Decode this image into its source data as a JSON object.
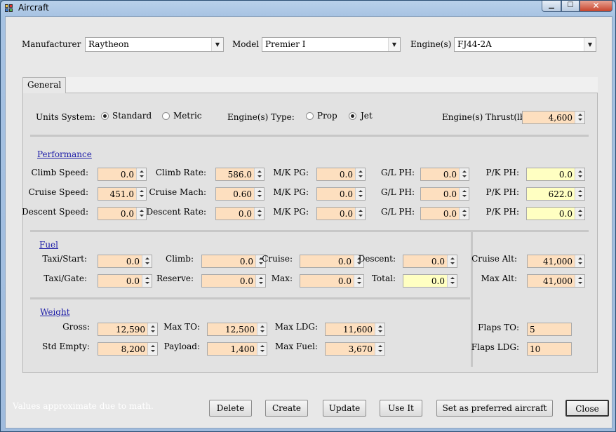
{
  "window": {
    "title": "Aircraft",
    "min": "▁",
    "max": "☐",
    "close": "✕"
  },
  "header": {
    "manufacturer_label": "Manufacturer",
    "manufacturer_value": "Raytheon",
    "model_label": "Model",
    "model_value": "Premier I",
    "engines_label": "Engine(s)",
    "engines_value": "FJ44-2A"
  },
  "tab": {
    "label": "General"
  },
  "general": {
    "units_label": "Units System:",
    "standard_label": "Standard",
    "metric_label": "Metric",
    "engine_type_label": "Engine(s) Type:",
    "prop_label": "Prop",
    "jet_label": "Jet",
    "thrust_label": "Engine(s) Thrust(lb):",
    "thrust_value": "4,600"
  },
  "performance": {
    "title": "Performance",
    "rows": [
      {
        "l1": "Climb Speed:",
        "v1": "0.0",
        "l2": "Climb Rate:",
        "v2": "586.0",
        "l3": "M/K PG:",
        "v3": "0.0",
        "l4": "G/L PH:",
        "v4": "0.0",
        "l5": "P/K PH:",
        "v5": "0.0"
      },
      {
        "l1": "Cruise Speed:",
        "v1": "451.0",
        "l2": "Cruise Mach:",
        "v2": "0.60",
        "l3": "M/K PG:",
        "v3": "0.0",
        "l4": "G/L PH:",
        "v4": "0.0",
        "l5": "P/K PH:",
        "v5": "622.0"
      },
      {
        "l1": "Descent Speed:",
        "v1": "0.0",
        "l2": "Descent Rate:",
        "v2": "0.0",
        "l3": "M/K PG:",
        "v3": "0.0",
        "l4": "G/L PH:",
        "v4": "0.0",
        "l5": "P/K PH:",
        "v5": "0.0"
      }
    ]
  },
  "fuel": {
    "title": "Fuel",
    "taxi_start_label": "Taxi/Start:",
    "taxi_start": "0.0",
    "climb_label": "Climb:",
    "climb": "0.0",
    "cruise_label": "Cruise:",
    "cruise": "0.0",
    "descent_label": "Descent:",
    "descent": "0.0",
    "taxi_gate_label": "Taxi/Gate:",
    "taxi_gate": "0.0",
    "reserve_label": "Reserve:",
    "reserve": "0.0",
    "max_label": "Max:",
    "max": "0.0",
    "total_label": "Total:",
    "total": "0.0"
  },
  "altitude": {
    "cruise_alt_label": "Cruise Alt:",
    "cruise_alt": "41,000",
    "max_alt_label": "Max Alt:",
    "max_alt": "41,000"
  },
  "weight": {
    "title": "Weight",
    "gross_label": "Gross:",
    "gross": "12,590",
    "max_to_label": "Max TO:",
    "max_to": "12,500",
    "max_ldg_label": "Max LDG:",
    "max_ldg": "11,600",
    "std_empty_label": "Std Empty:",
    "std_empty": "8,200",
    "payload_label": "Payload:",
    "payload": "1,400",
    "max_fuel_label": "Max Fuel:",
    "max_fuel": "3,670"
  },
  "flaps": {
    "to_label": "Flaps TO:",
    "to_value": "5",
    "ldg_label": "Flaps LDG:",
    "ldg_value": "10"
  },
  "footer": {
    "note": "Values approximate due to  math.",
    "delete": "Delete",
    "create": "Create",
    "update": "Update",
    "use_it": "Use It",
    "preferred": "Set as preferred aircraft",
    "close": "Close"
  }
}
